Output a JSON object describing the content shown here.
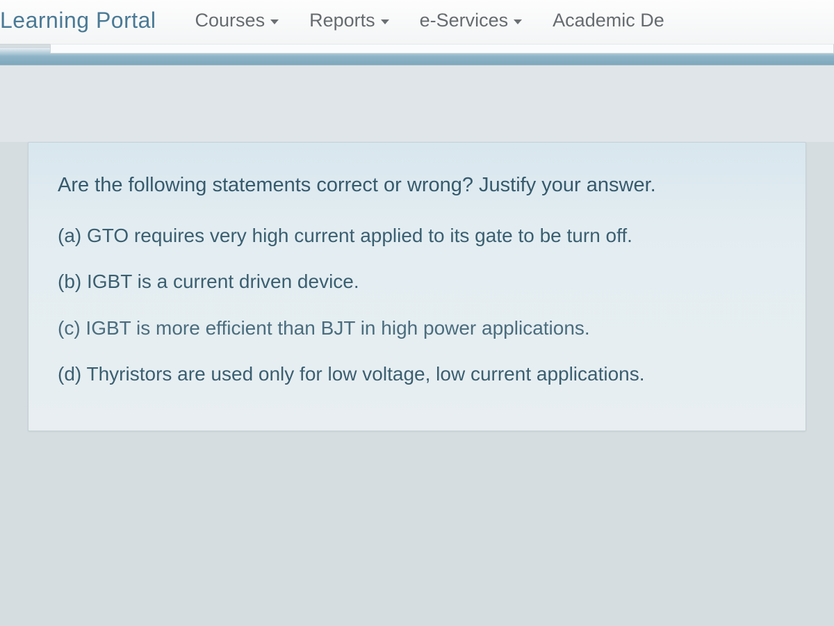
{
  "navbar": {
    "brand": "Learning Portal",
    "items": [
      {
        "label": "Courses"
      },
      {
        "label": "Reports"
      },
      {
        "label": "e-Services"
      },
      {
        "label": "Academic De"
      }
    ]
  },
  "question": {
    "prompt": "Are the following statements correct or wrong? Justify your answer.",
    "options": [
      "(a) GTO requires very high current applied to its gate to be turn off.",
      "(b) IGBT is a current driven device.",
      "(c) IGBT is more efficient than BJT in high power applications.",
      "(d) Thyristors are used only for low voltage, low current applications."
    ]
  }
}
